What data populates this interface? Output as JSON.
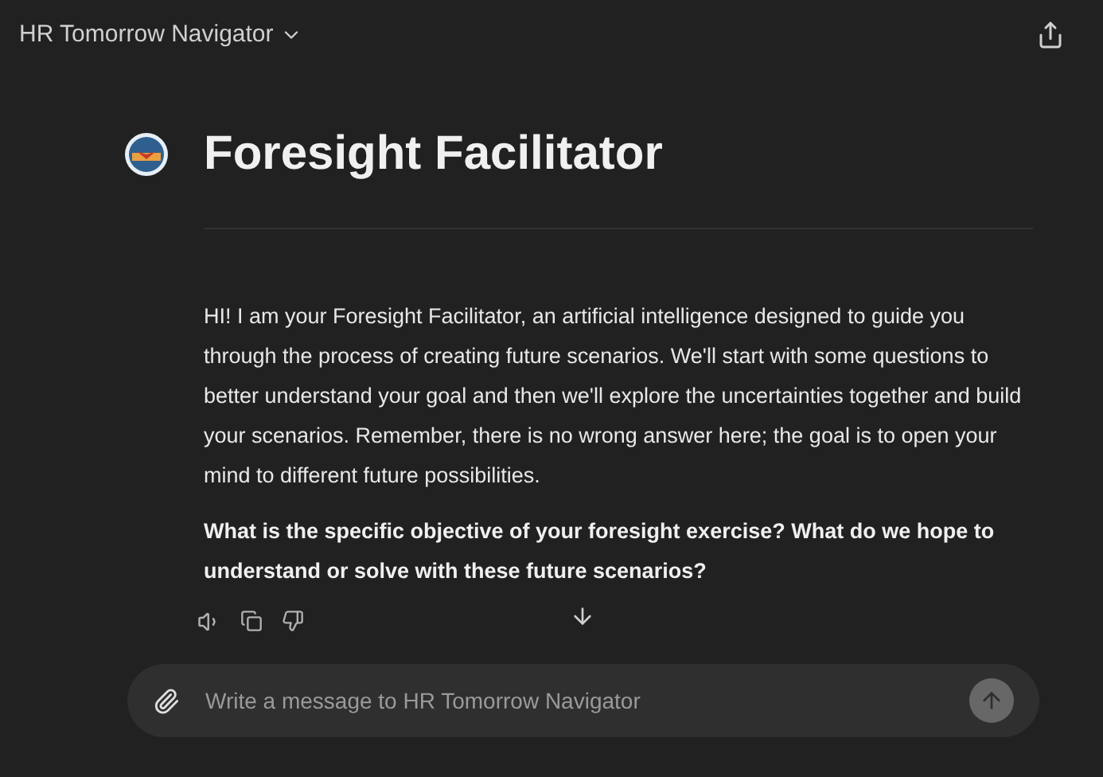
{
  "header": {
    "title": "HR Tomorrow Navigator"
  },
  "assistant": {
    "name": "Foresight Facilitator"
  },
  "message": {
    "text": "HI! I am your Foresight Facilitator, an artificial intelligence designed to guide you through the process of creating future scenarios. We'll start with some questions to better understand your goal and then we'll explore the uncertainties together and build your scenarios. Remember, there is no wrong answer here; the goal is to open your mind to different future possibilities.",
    "question": "What is the specific objective of your foresight exercise? What do we hope to understand or solve with these future scenarios?"
  },
  "composer": {
    "placeholder": "Write a message to HR Tomorrow Navigator"
  }
}
